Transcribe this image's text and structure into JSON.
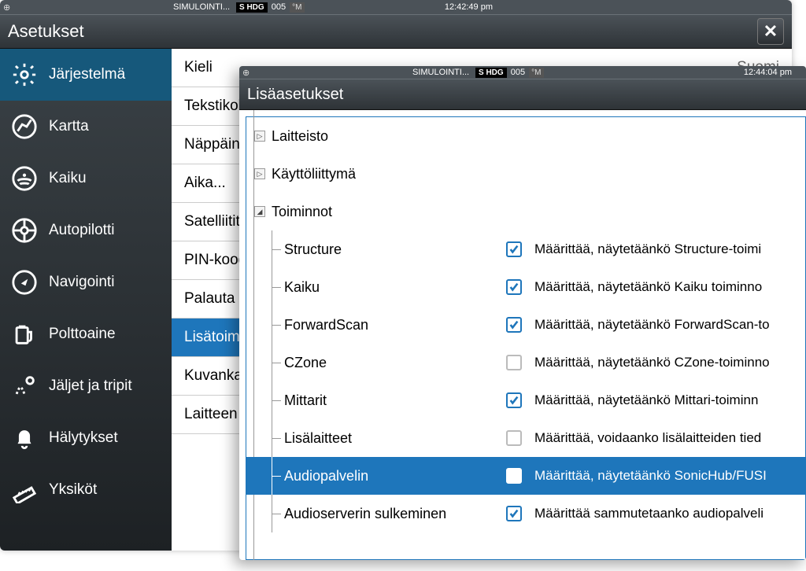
{
  "back": {
    "status": {
      "sim": "SIMULOINTI...",
      "hdg_lbl": "S HDG",
      "hdg_val": "005",
      "hdg_unit": "°M",
      "clock": "12:42:49 pm"
    },
    "title": "Asetukset",
    "sidebar": [
      {
        "label": "Järjestelmä",
        "icon": "gear",
        "active": true
      },
      {
        "label": "Kartta",
        "icon": "chart"
      },
      {
        "label": "Kaiku",
        "icon": "sonar"
      },
      {
        "label": "Autopilotti",
        "icon": "wheel"
      },
      {
        "label": "Navigointi",
        "icon": "compass"
      },
      {
        "label": "Polttoaine",
        "icon": "fuel"
      },
      {
        "label": "Jäljet ja tripit",
        "icon": "tracks"
      },
      {
        "label": "Hälytykset",
        "icon": "bell"
      },
      {
        "label": "Yksiköt",
        "icon": "ruler"
      }
    ],
    "rows": [
      {
        "label": "Kieli",
        "value": "Suomi"
      },
      {
        "label": "Tekstikok"
      },
      {
        "label": "Näppäinä"
      },
      {
        "label": "Aika..."
      },
      {
        "label": "Satelliitit"
      },
      {
        "label": "PIN-koodi"
      },
      {
        "label": "Palauta o"
      },
      {
        "label": "Lisätoimi",
        "active": true
      },
      {
        "label": "Kuvankaa"
      },
      {
        "label": "Laitteen t"
      }
    ]
  },
  "front": {
    "status": {
      "sim": "SIMULOINTI...",
      "hdg_lbl": "S HDG",
      "hdg_val": "005",
      "hdg_unit": "°M",
      "clock": "12:44:04 pm"
    },
    "title": "Lisäasetukset",
    "tops": [
      {
        "label": "Laitteisto",
        "expanded": false
      },
      {
        "label": "Käyttöliittymä",
        "expanded": false
      },
      {
        "label": "Toiminnot",
        "expanded": true
      }
    ],
    "children": [
      {
        "label": "Structure",
        "checked": true,
        "desc": "Määrittää, näytetäänkö Structure-toimi"
      },
      {
        "label": "Kaiku",
        "checked": true,
        "desc": "Määrittää, näytetäänkö Kaiku toiminno"
      },
      {
        "label": "ForwardScan",
        "checked": true,
        "desc": "Määrittää, näytetäänkö ForwardScan-to"
      },
      {
        "label": "CZone",
        "checked": false,
        "desc": "Määrittää, näytetäänkö CZone-toiminno"
      },
      {
        "label": "Mittarit",
        "checked": true,
        "desc": "Määrittää, näytetäänkö Mittari-toiminn"
      },
      {
        "label": "Lisälaitteet",
        "checked": false,
        "desc": "Määrittää, voidaanko lisälaitteiden tied"
      },
      {
        "label": "Audiopalvelin",
        "checked": false,
        "selected": true,
        "desc": "Määrittää, näytetäänkö SonicHub/FUSI"
      },
      {
        "label": "Audioserverin sulkeminen",
        "checked": true,
        "desc": "Määrittää sammutetaanko audiopalveli"
      }
    ]
  }
}
